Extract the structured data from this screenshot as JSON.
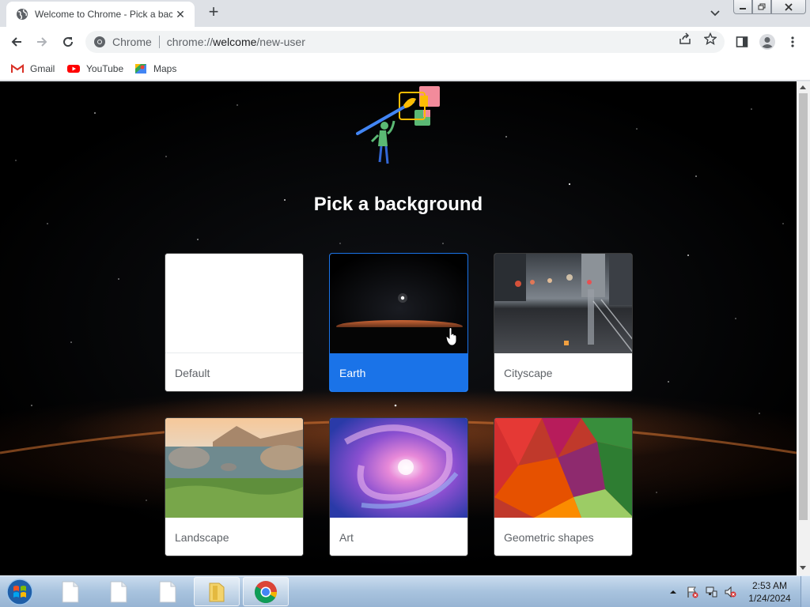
{
  "browser": {
    "tab": {
      "title": "Welcome to Chrome - Pick a bac",
      "close_glyph": "✕"
    },
    "new_tab_glyph": "+",
    "omnibox": {
      "chip": "Chrome",
      "url_prefix": "chrome://",
      "url_host": "welcome",
      "url_path": "/new-user"
    },
    "bookmarks": [
      {
        "label": "Gmail",
        "icon": "gmail-icon"
      },
      {
        "label": "YouTube",
        "icon": "youtube-icon"
      },
      {
        "label": "Maps",
        "icon": "maps-icon"
      }
    ]
  },
  "page": {
    "title": "Pick a background",
    "backgrounds": [
      {
        "label": "Default",
        "selected": false
      },
      {
        "label": "Earth",
        "selected": true
      },
      {
        "label": "Cityscape",
        "selected": false
      },
      {
        "label": "Landscape",
        "selected": false
      },
      {
        "label": "Art",
        "selected": false
      },
      {
        "label": "Geometric shapes",
        "selected": false
      }
    ]
  },
  "taskbar": {
    "clock": {
      "time": "2:53 AM",
      "date": "1/24/2024"
    },
    "pinned": [
      "document-icon",
      "document-icon",
      "document-icon",
      "file-explorer-icon",
      "chrome-icon"
    ]
  },
  "colors": {
    "accent": "#1a73e8",
    "page_bg": "#000000",
    "tabstrip": "#dee1e6"
  }
}
